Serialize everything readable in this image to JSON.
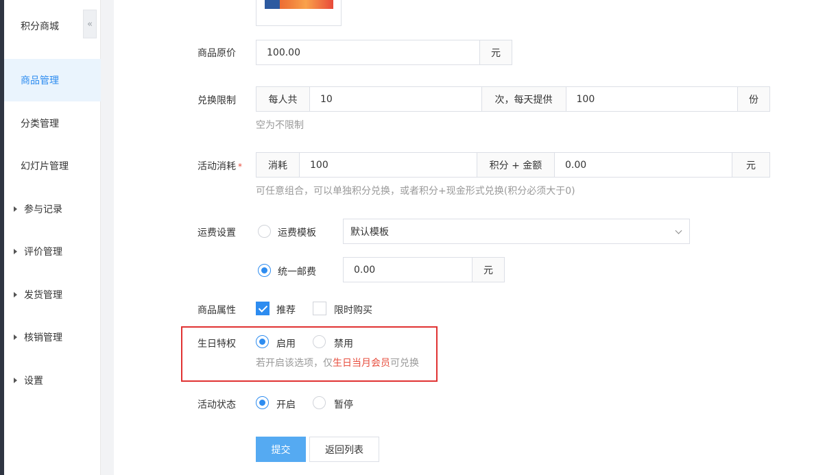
{
  "sidebar": {
    "title": "积分商城",
    "collapse_icon": "«",
    "items": [
      {
        "label": "商品管理"
      },
      {
        "label": "分类管理"
      },
      {
        "label": "幻灯片管理"
      },
      {
        "label": "参与记录"
      },
      {
        "label": "评价管理"
      },
      {
        "label": "发货管理"
      },
      {
        "label": "核销管理"
      },
      {
        "label": "设置"
      }
    ]
  },
  "form": {
    "original_price": {
      "label": "商品原价",
      "value": "100.00",
      "unit": "元"
    },
    "exchange_limit": {
      "label": "兑换限制",
      "prefix": "每人共",
      "value1": "10",
      "middle": "次，每天提供",
      "value2": "100",
      "unit": "份",
      "hint": "空为不限制"
    },
    "activity_cost": {
      "label": "活动消耗",
      "required_mark": "*",
      "prefix": "消耗",
      "points": "100",
      "middle": "积分 + 金额",
      "amount": "0.00",
      "unit": "元",
      "hint": "可任意组合，可以单独积分兑换，或者积分+现金形式兑换(积分必须大于0)"
    },
    "shipping": {
      "label": "运费设置",
      "option_template": "运费模板",
      "template_selected": "默认模板",
      "option_flat": "统一邮费",
      "flat_value": "0.00",
      "flat_unit": "元"
    },
    "attributes": {
      "label": "商品属性",
      "recommend": "推荐",
      "limited": "限时购买"
    },
    "birthday": {
      "label": "生日特权",
      "enable": "启用",
      "disable": "禁用",
      "hint_pre": "若开启该选项，仅",
      "hint_red": "生日当月会员",
      "hint_post": "可兑换"
    },
    "status": {
      "label": "活动状态",
      "on": "开启",
      "pause": "暂停"
    }
  },
  "buttons": {
    "submit": "提交",
    "back": "返回列表"
  },
  "colors": {
    "accent": "#2d8cf0",
    "highlight_border": "#e03131",
    "hint_red": "#e74c3c"
  }
}
